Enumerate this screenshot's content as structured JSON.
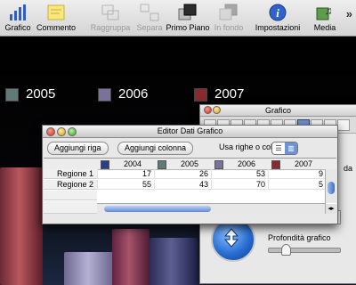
{
  "toolbar": {
    "items": [
      {
        "label": "Grafico",
        "icon": "bar-chart-icon",
        "enabled": true
      },
      {
        "label": "Commento",
        "icon": "comment-note-icon",
        "enabled": true
      },
      {
        "label": "Raggruppa",
        "icon": "group-icon",
        "enabled": false
      },
      {
        "label": "Separa",
        "icon": "ungroup-icon",
        "enabled": false
      },
      {
        "label": "Primo Piano",
        "icon": "bring-front-icon",
        "enabled": true
      },
      {
        "label": "In fondo",
        "icon": "send-back-icon",
        "enabled": false
      },
      {
        "label": "Impostazioni",
        "icon": "info-icon",
        "enabled": true
      },
      {
        "label": "Media",
        "icon": "media-icon",
        "enabled": true
      }
    ],
    "overflow": "»"
  },
  "slide": {
    "legend": [
      {
        "label": "2005",
        "color": "#5f7a77"
      },
      {
        "label": "2006",
        "color": "#7a729a"
      },
      {
        "label": "2007",
        "color": "#8a2a30"
      }
    ]
  },
  "inspector": {
    "title": "Grafico",
    "cut_label": "da",
    "depth_label": "Profondità grafico"
  },
  "editor": {
    "title": "Editor Dati Grafico",
    "add_row": "Aggiungi riga",
    "add_column": "Aggiungi colonna",
    "rows_or_columns": "Usa righe o colonne:",
    "columns": [
      {
        "label": "2004",
        "color": "#2a3f86"
      },
      {
        "label": "2005",
        "color": "#5f7a77"
      },
      {
        "label": "2006",
        "color": "#7a729a"
      },
      {
        "label": "2007",
        "color": "#8a2a30"
      }
    ],
    "rows": [
      {
        "label": "Regione 1",
        "values": [
          "17",
          "26",
          "53",
          "9"
        ]
      },
      {
        "label": "Regione 2",
        "values": [
          "55",
          "43",
          "70",
          "5"
        ]
      }
    ]
  }
}
